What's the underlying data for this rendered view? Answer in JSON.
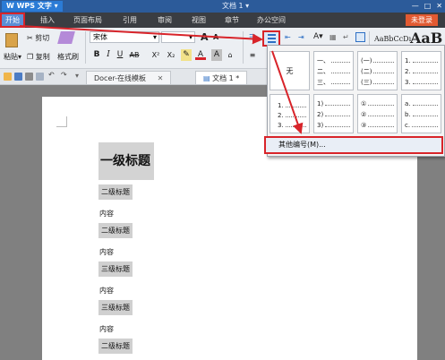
{
  "titlebar": {
    "app_name": "W WPS 文字",
    "app_caret": "▾",
    "doc_title": "文档 1 ▾",
    "minimize": "—",
    "maximize": "□",
    "close": "✕"
  },
  "menu": {
    "items": [
      "开始",
      "插入",
      "页面布局",
      "引用",
      "审阅",
      "视图",
      "章节",
      "办公空间"
    ],
    "active_index": 0,
    "login": "未登录"
  },
  "ribbon": {
    "paste": "粘贴",
    "cut": "剪切",
    "copy": "复制",
    "format_painter": "格式刷",
    "font_name": "宋体",
    "font_size": "",
    "bold": "B",
    "italic": "I",
    "underline": "U",
    "strike": "AB",
    "superscript": "X²",
    "subscript": "X₂",
    "font_color": "A",
    "char_shade": "A",
    "grow_font": "A",
    "shrink_font": "A",
    "style_sample_1": "AaBbCcDı",
    "style_sample_2": "AaB"
  },
  "tabs": {
    "docer": "Docer-在线模板",
    "doc1": "文档 1 *"
  },
  "document": {
    "h1": "一级标题",
    "paragraphs": [
      {
        "kind": "h2",
        "text": "二级标题"
      },
      {
        "kind": "body",
        "text": "内容"
      },
      {
        "kind": "h2",
        "text": "二级标题"
      },
      {
        "kind": "body",
        "text": "内容"
      },
      {
        "kind": "h2",
        "text": "三级标题"
      },
      {
        "kind": "body",
        "text": "内容"
      },
      {
        "kind": "h2",
        "text": "三级标题"
      },
      {
        "kind": "body",
        "text": "内容"
      },
      {
        "kind": "h2",
        "text": "二级标题"
      }
    ]
  },
  "numbering": {
    "none": "无",
    "styles": [
      [
        "一、",
        "二、",
        "三、"
      ],
      [
        "(一)",
        "(二)",
        "(三)"
      ],
      [
        "1.",
        "2.",
        "3."
      ],
      [
        "1.",
        "2.",
        "3."
      ],
      [
        "1)",
        "2)",
        "3)"
      ],
      [
        "①",
        "②",
        "③"
      ],
      [
        "a.",
        "b.",
        "c."
      ]
    ],
    "more": "其他编号(M)..."
  },
  "colors": {
    "highlight": "#d8242a",
    "menubar": "#3a3d42",
    "titlebar": "#2c5b9a"
  }
}
